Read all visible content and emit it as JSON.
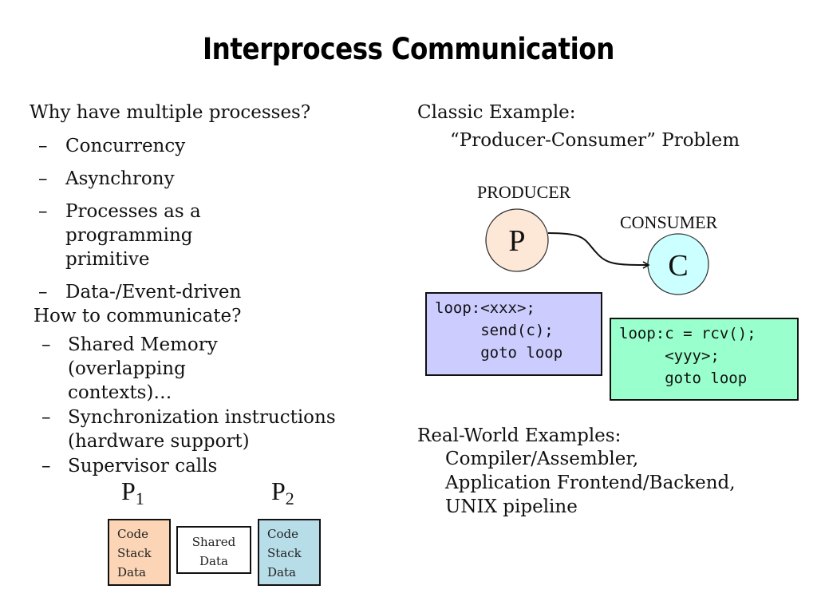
{
  "title": "Interprocess Communication",
  "left": {
    "why": {
      "heading": "Why have multiple processes?",
      "items": [
        {
          "dash": "–",
          "text": "Concurrency"
        },
        {
          "dash": "–",
          "text": "Asynchrony"
        },
        {
          "dash": "–",
          "text": "Processes as a programming primitive"
        },
        {
          "dash": "–",
          "text": "Data-/Event-driven"
        }
      ]
    },
    "how": {
      "heading": "How to communicate?",
      "items": [
        {
          "dash": "–",
          "text": "Shared Memory (overlapping contexts)…"
        },
        {
          "dash": "–",
          "text": "Synchronization instructions (hardware support)"
        },
        {
          "dash": "–",
          "text": "Supervisor calls"
        }
      ]
    },
    "memory_diagram": {
      "p1": {
        "label": "P",
        "sub": "1",
        "lines": [
          "Code",
          "Stack",
          "Data"
        ],
        "color": "#fbd5b5"
      },
      "shared": {
        "lines": [
          "Shared",
          "Data"
        ],
        "color": "#ffffff"
      },
      "p2": {
        "label": "P",
        "sub": "2",
        "lines": [
          "Code",
          "Stack",
          "Data"
        ],
        "color": "#b7dde8"
      }
    }
  },
  "right": {
    "classic": {
      "line1": "Classic Example:",
      "line2": "“Producer-Consumer” Problem"
    },
    "diagram": {
      "producer_label": "PRODUCER",
      "consumer_label": "CONSUMER",
      "producer_node": {
        "letter": "P",
        "color": "#fde8d8"
      },
      "consumer_node": {
        "letter": "C",
        "color": "#ccffff"
      }
    },
    "producer_code": {
      "lines": [
        "loop:<xxx>;",
        "     send(c);",
        "     goto loop"
      ],
      "color": "#ccccff"
    },
    "consumer_code": {
      "lines": [
        "loop:c = rcv();",
        "     <yyy>;",
        "     goto loop"
      ],
      "color": "#99ffcc"
    },
    "real_world": {
      "heading": "Real-World Examples:",
      "items": [
        "Compiler/Assembler,",
        "Application Frontend/Backend,",
        "UNIX pipeline"
      ]
    }
  }
}
